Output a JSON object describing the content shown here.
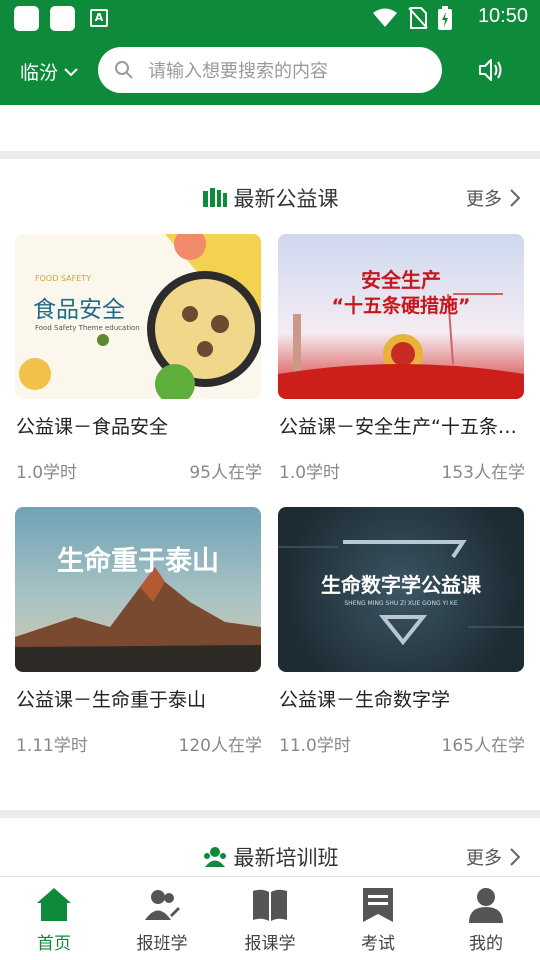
{
  "status": {
    "time": "10:50",
    "notif_letter": "A"
  },
  "header": {
    "city": "临汾",
    "search_placeholder": "请输入想要搜索的内容"
  },
  "section_courses": {
    "title": "最新公益课",
    "more": "更多",
    "cards": [
      {
        "title": "公益课－食品安全",
        "hours": "1.0学时",
        "learners": "95人在学",
        "thumb_lines": [
          "FOOD SAFETY",
          "食品安全",
          "Food Safety Theme education"
        ]
      },
      {
        "title": "公益课－安全生产“十五条硬措施”",
        "hours": "1.0学时",
        "learners": "153人在学",
        "thumb_lines": [
          "安全生产",
          "“十五条硬措施”"
        ]
      },
      {
        "title": "公益课－生命重于泰山",
        "hours": "1.11学时",
        "learners": "120人在学",
        "thumb_lines": [
          "生命重于泰山"
        ]
      },
      {
        "title": "公益课－生命数字学",
        "hours": "11.0学时",
        "learners": "165人在学",
        "thumb_lines": [
          "生命数字学公益课",
          "SHENG MING SHU ZI XUE GONG YI KE"
        ]
      }
    ]
  },
  "section_training": {
    "title": "最新培训班",
    "more": "更多"
  },
  "nav": [
    {
      "label": "首页",
      "active": true
    },
    {
      "label": "报班学",
      "active": false
    },
    {
      "label": "报课学",
      "active": false
    },
    {
      "label": "考试",
      "active": false
    },
    {
      "label": "我的",
      "active": false
    }
  ],
  "colors": {
    "brand_green": "#0e8a3b",
    "divider": "#ececec"
  }
}
